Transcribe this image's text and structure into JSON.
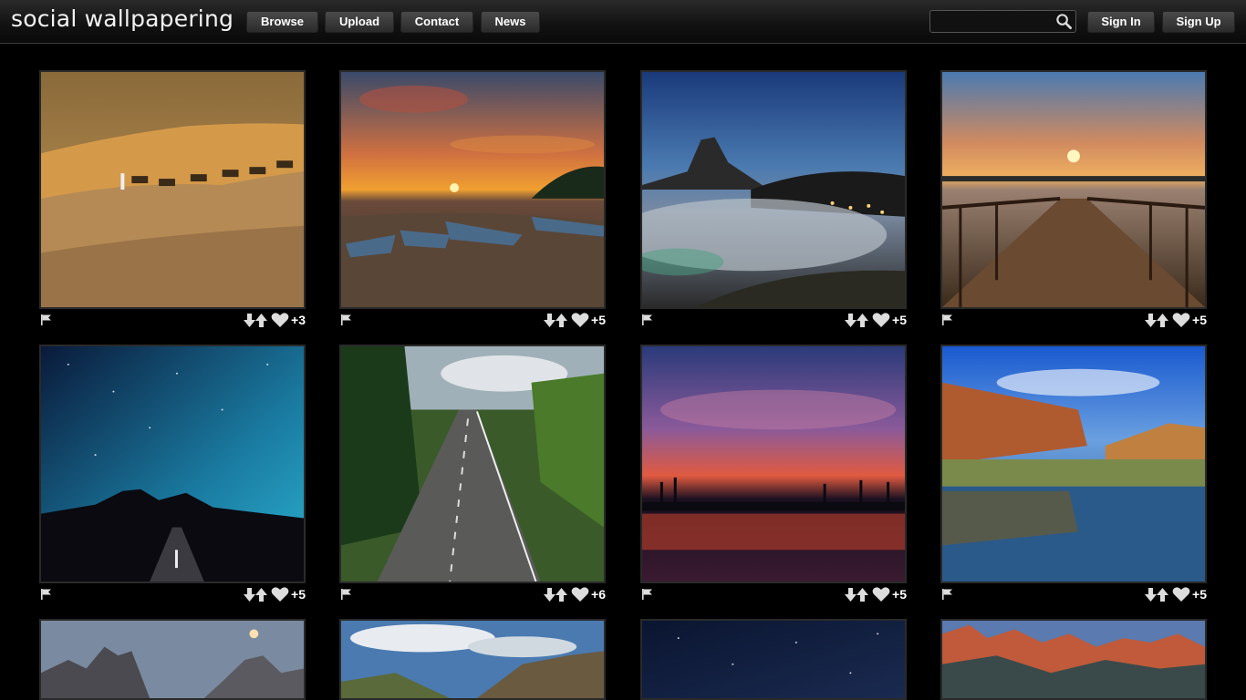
{
  "header": {
    "logo": "social wallpapering",
    "nav": {
      "browse": "Browse",
      "upload": "Upload",
      "contact": "Contact",
      "news": "News"
    },
    "search": {
      "value": "",
      "placeholder": ""
    },
    "auth": {
      "sign_in": "Sign In",
      "sign_up": "Sign Up"
    }
  },
  "wallpapers": [
    {
      "subject": "camel caravan in desert dunes",
      "score": "+3"
    },
    {
      "subject": "boats on shore at sunset",
      "score": "+5"
    },
    {
      "subject": "mountain peak above sea of fog at night",
      "score": "+5"
    },
    {
      "subject": "wooden pier at sunset",
      "score": "+5"
    },
    {
      "subject": "milky way over desert road",
      "score": "+5"
    },
    {
      "subject": "road through green forest hills",
      "score": "+6"
    },
    {
      "subject": "palm silhouettes at tropical sunset",
      "score": "+5"
    },
    {
      "subject": "red canyon cliffs reflected in lake",
      "score": "+5"
    },
    {
      "subject": "rocky mountain peaks at dusk",
      "score": ""
    },
    {
      "subject": "green mountains under cloudy sky",
      "score": ""
    },
    {
      "subject": "starry night sky",
      "score": ""
    },
    {
      "subject": "red snowy mountain range",
      "score": ""
    }
  ],
  "icons": {
    "report": "flag-icon",
    "downvote": "arrow-down-icon",
    "upvote": "arrow-up-icon",
    "favorite": "heart-icon",
    "search": "search-icon"
  },
  "colors": {
    "background": "#000000",
    "button": "#3a3a3a",
    "text": "#ffffff"
  }
}
